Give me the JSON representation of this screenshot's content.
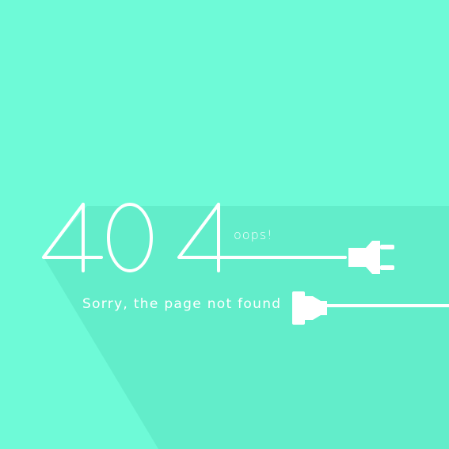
{
  "error": {
    "code": "404",
    "exclamation": "oops!",
    "message": "Sorry, the page not found"
  },
  "colors": {
    "background": "#6EFAD7",
    "shadow": "#62EDCA",
    "foreground": "#FFFFFF"
  },
  "icons": {
    "plug": "power-plug-icon",
    "socket": "power-socket-icon"
  }
}
